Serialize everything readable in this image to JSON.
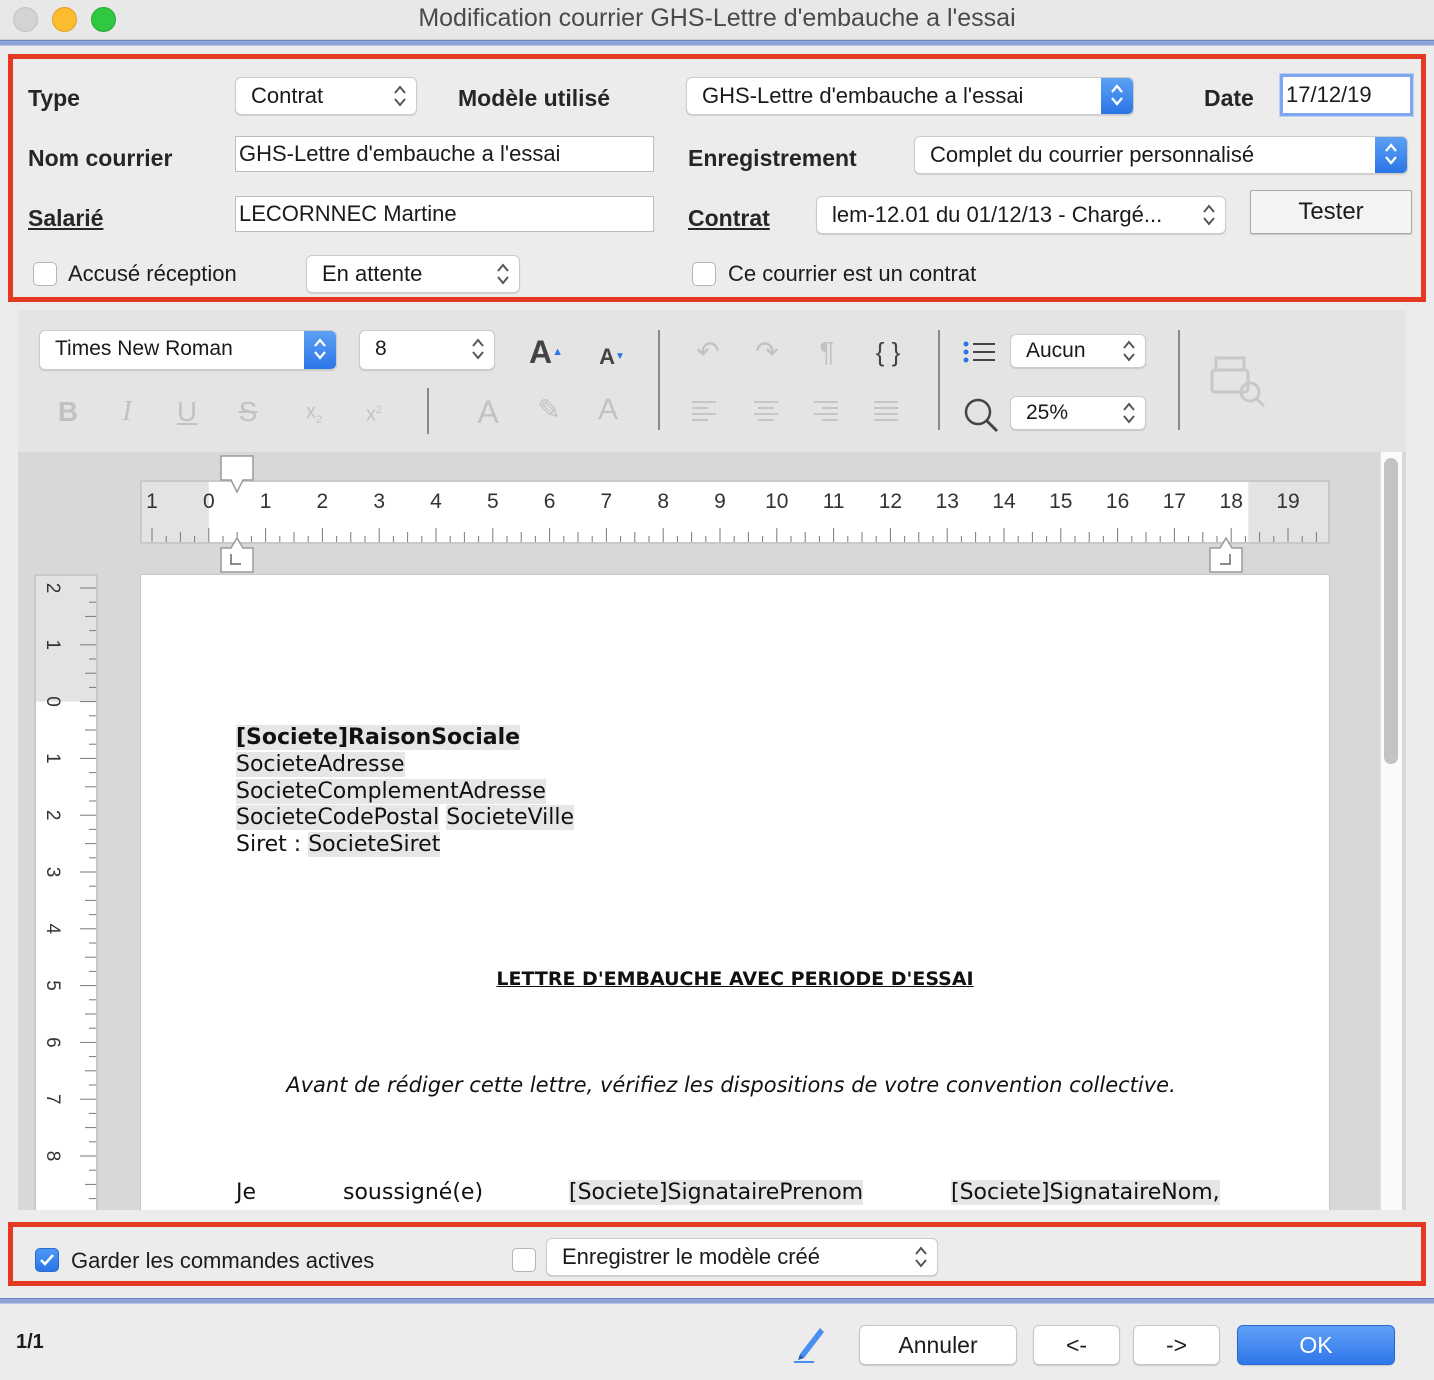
{
  "window": {
    "title": "Modification courrier GHS-Lettre d'embauche a l'essai"
  },
  "form": {
    "type_label": "Type",
    "type_value": "Contrat",
    "modele_label": "Modèle utilisé",
    "modele_value": "GHS-Lettre d'embauche a l'essai",
    "date_label": "Date",
    "date_value": "17/12/19",
    "nom_label": "Nom courrier",
    "nom_value": "GHS-Lettre d'embauche a l'essai",
    "enregistrement_label": "Enregistrement",
    "enregistrement_value": "Complet du courrier personnalisé",
    "salarie_label": "Salarié",
    "salarie_value": "LECORNNEC Martine",
    "contrat_label": "Contrat",
    "contrat_value": "lem-12.01 du 01/12/13 - Chargé...",
    "tester_label": "Tester",
    "accuse_label": "Accusé réception",
    "accuse_checked": false,
    "accuse_status": "En attente",
    "contrat_chk_label": "Ce courrier est un contrat",
    "contrat_chk_checked": false
  },
  "toolbar": {
    "font": "Times New Roman",
    "size": "8",
    "list_style": "Aucun",
    "zoom": "25%"
  },
  "ruler": {
    "h_ticks": [
      "1",
      "0",
      "1",
      "2",
      "3",
      "4",
      "5",
      "6",
      "7",
      "8",
      "9",
      "10",
      "11",
      "12",
      "13",
      "14",
      "15",
      "16",
      "17",
      "18",
      "19"
    ],
    "v_ticks": [
      "2",
      "1",
      "0",
      "1",
      "2",
      "3",
      "4",
      "5",
      "6",
      "7",
      "8"
    ]
  },
  "document": {
    "line1": "[Societe]RaisonSociale",
    "line2": "SocieteAdresse",
    "line3": "SocieteComplementAdresse",
    "line4a": "SocieteCodePostal",
    "line4b": "SocieteVille",
    "line5a": "Siret : ",
    "line5b": "SocieteSiret",
    "heading": "LETTRE D'EMBAUCHE AVEC PERIODE D'ESSAI",
    "note": "Avant de rédiger cette lettre, vérifiez les dispositions de votre convention collective.",
    "w1": "Je",
    "w2": "soussigné(e)",
    "w3": "[Societe]SignatairePrenom",
    "w4": "[Societe]SignataireNom,"
  },
  "bottom_panel": {
    "garder_label": "Garder les commandes actives",
    "garder_checked": true,
    "enregistrer_checked": false,
    "enregistrer_value": "Enregistrer le modèle créé"
  },
  "footer": {
    "page": "1/1",
    "annuler": "Annuler",
    "prev": "<-",
    "next": "->",
    "ok": "OK"
  }
}
